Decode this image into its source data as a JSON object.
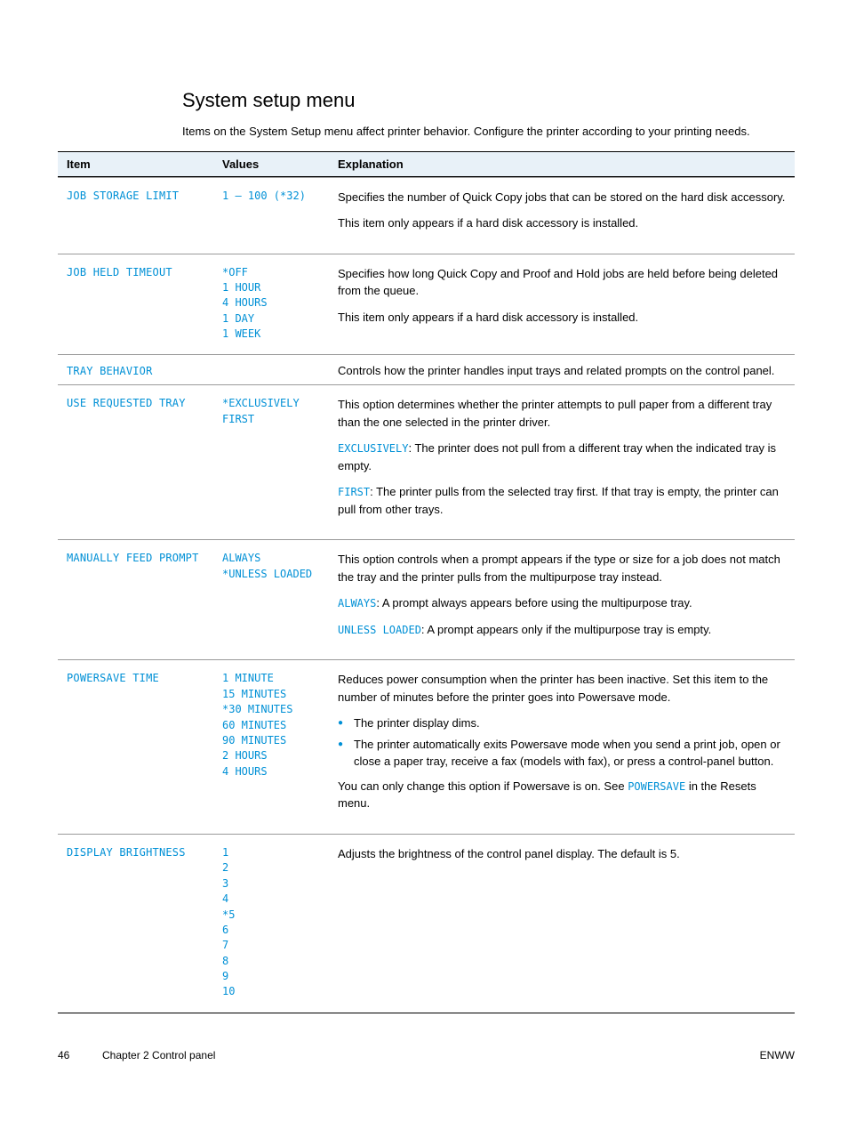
{
  "menu": {
    "title": "System setup menu",
    "lead": "Items on the System Setup menu affect printer behavior. Configure the printer according to your printing needs."
  },
  "table": {
    "head": {
      "item": "Item",
      "values": "Values",
      "explanation": "Explanation"
    }
  },
  "rows": {
    "job_storage_limit": {
      "item": "JOB STORAGE LIMIT",
      "values_line": "1 – 100 (*32)",
      "expl_1": "Specifies the number of Quick Copy jobs that can be stored on the hard disk accessory.",
      "expl_2": "This item only appears if a hard disk accessory is installed."
    },
    "job_held_timeout": {
      "item": "JOB HELD TIMEOUT",
      "values": "*OFF\n1 HOUR\n4 HOURS\n1 DAY\n1 WEEK",
      "expl_1": "Specifies how long Quick Copy and Proof and Hold jobs are held before being deleted from the queue.",
      "expl_2": "This item only appears if a hard disk accessory is installed."
    },
    "tray_behavior": {
      "item": "TRAY BEHAVIOR",
      "expl": "Controls how the printer handles input trays and related prompts on the control panel."
    },
    "use_requested_tray": {
      "item": "USE REQUESTED TRAY",
      "values": "*EXCLUSIVELY\nFIRST",
      "expl_intro": "This option determines whether the printer attempts to pull paper from a different tray than the one selected in the printer driver.",
      "opt1_label": "EXCLUSIVELY",
      "opt1_text": ": The printer does not pull from a different tray when the indicated tray is empty.",
      "opt2_label": "FIRST",
      "opt2_text": ": The printer pulls from the selected tray first. If that tray is empty, the printer can pull from other trays."
    },
    "manually_feed_prompt": {
      "item": "MANUALLY FEED PROMPT",
      "values": "ALWAYS\n*UNLESS LOADED",
      "expl_intro": "This option controls when a prompt appears if the type or size for a job does not match the tray and the printer pulls from the multipurpose tray instead.",
      "opt1_label": "ALWAYS",
      "opt1_text": ": A prompt always appears before using the multipurpose tray.",
      "opt2_label": "UNLESS LOADED",
      "opt2_text": ": A prompt appears only if the multipurpose tray is empty."
    },
    "powersave_time": {
      "item": "POWERSAVE TIME",
      "values": "1 MINUTE\n15 MINUTES\n*30 MINUTES\n60 MINUTES\n90 MINUTES\n2 HOURS\n4 HOURS",
      "expl_intro": "Reduces power consumption when the printer has been inactive. Set this item to the number of minutes before the printer goes into Powersave mode.",
      "bullet1": "The printer display dims.",
      "bullet2": "The printer automatically exits Powersave mode when you send a print job, open or close a paper tray, receive a fax (models with fax), or press a control-panel button.",
      "expl_trail_1": "You can only change this option if Powersave is on. See ",
      "expl_link": "POWERSAVE",
      "expl_trail_2": " in the Resets menu."
    },
    "display_brightness": {
      "item": "DISPLAY BRIGHTNESS",
      "values": "1\n2\n3\n4\n*5\n6\n7\n8\n9\n10",
      "expl": "Adjusts the brightness of the control panel display. The default is 5."
    }
  },
  "footer": {
    "page": "46",
    "chapter": "Chapter 2 Control panel",
    "enww": "ENWW"
  }
}
